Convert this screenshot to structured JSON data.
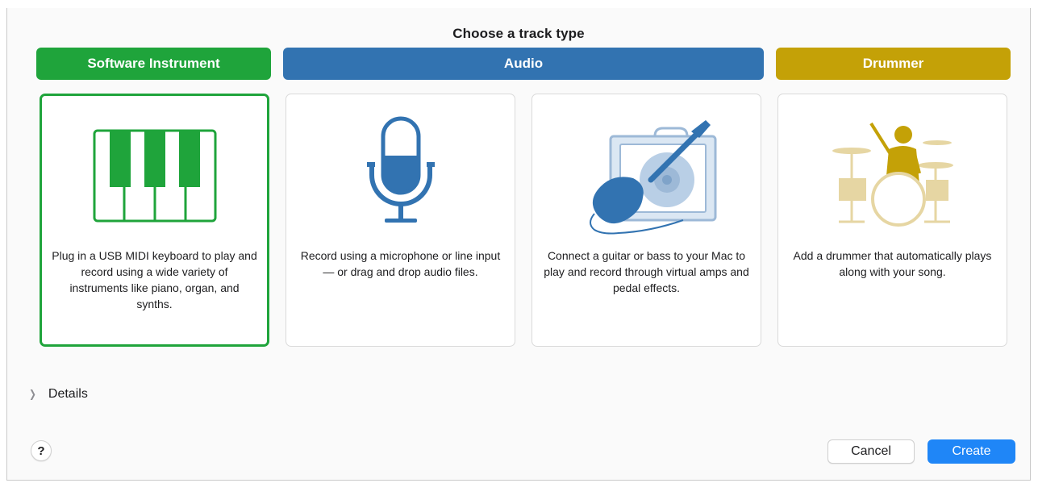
{
  "dialog": {
    "title": "Choose a track type"
  },
  "categories": {
    "software_instrument": "Software Instrument",
    "audio": "Audio",
    "drummer": "Drummer"
  },
  "cards": [
    {
      "icon": "piano-keyboard-icon",
      "description": "Plug in a USB MIDI keyboard to play and record using a wide variety of instruments like piano, organ, and synths.",
      "selected": true
    },
    {
      "icon": "microphone-icon",
      "description": "Record using a microphone or line input — or drag and drop audio files.",
      "selected": false
    },
    {
      "icon": "guitar-amp-icon",
      "description": "Connect a guitar or bass to your Mac to play and record through virtual amps and pedal effects.",
      "selected": false
    },
    {
      "icon": "drummer-icon",
      "description": "Add a drummer that automatically plays along with your song.",
      "selected": false
    }
  ],
  "details": {
    "label": "Details",
    "expanded": false
  },
  "help": {
    "label": "?"
  },
  "buttons": {
    "cancel": "Cancel",
    "create": "Create"
  },
  "colors": {
    "software_instrument": "#1fa43b",
    "audio": "#3273b1",
    "drummer": "#c4a107",
    "primary_button": "#1f86f7"
  }
}
